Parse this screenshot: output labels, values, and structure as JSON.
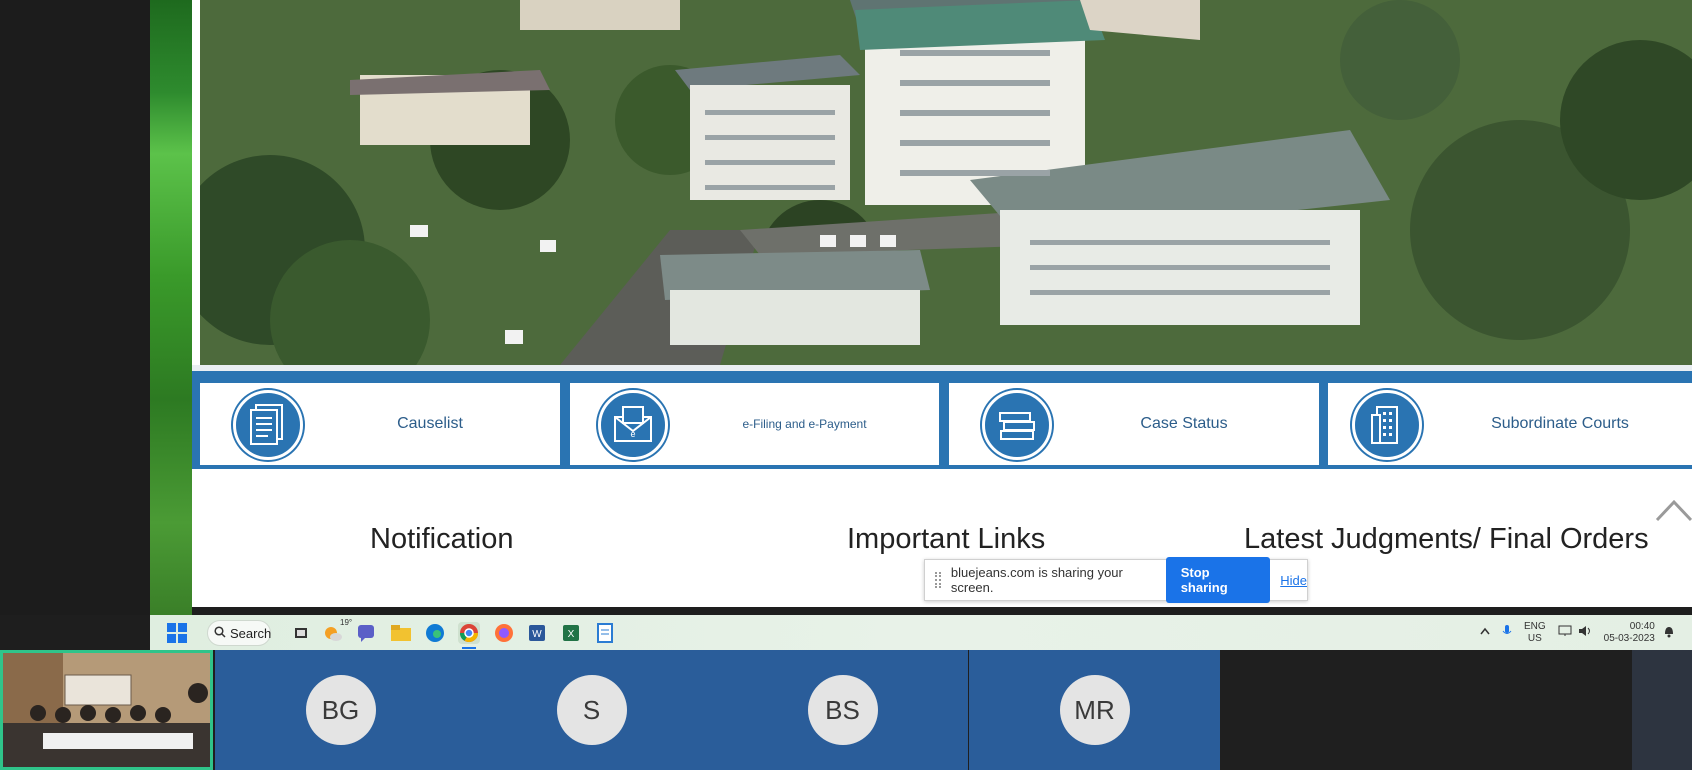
{
  "browser": {
    "tiles": [
      {
        "label": "Causelist",
        "icon": "document-list-icon"
      },
      {
        "label": "e-Filing and e-Payment",
        "icon": "mail-envelope-icon"
      },
      {
        "label": "Case Status",
        "icon": "books-icon"
      },
      {
        "label": "Subordinate Courts",
        "icon": "building-icon"
      }
    ],
    "sections": {
      "notification": "Notification",
      "important_links": "Important Links",
      "latest_judgments": "Latest Judgments/ Final Orders"
    }
  },
  "share_bar": {
    "message": "bluejeans.com is sharing your screen.",
    "stop_label": "Stop sharing",
    "hide_label": "Hide"
  },
  "taskbar": {
    "search_label": "Search",
    "weather": "19°",
    "language": "ENG",
    "region": "US",
    "time": "00:40",
    "date": "05-03-2023"
  },
  "participants": [
    {
      "initials": "BG"
    },
    {
      "initials": "S"
    },
    {
      "initials": "BS"
    },
    {
      "initials": "MR"
    }
  ]
}
